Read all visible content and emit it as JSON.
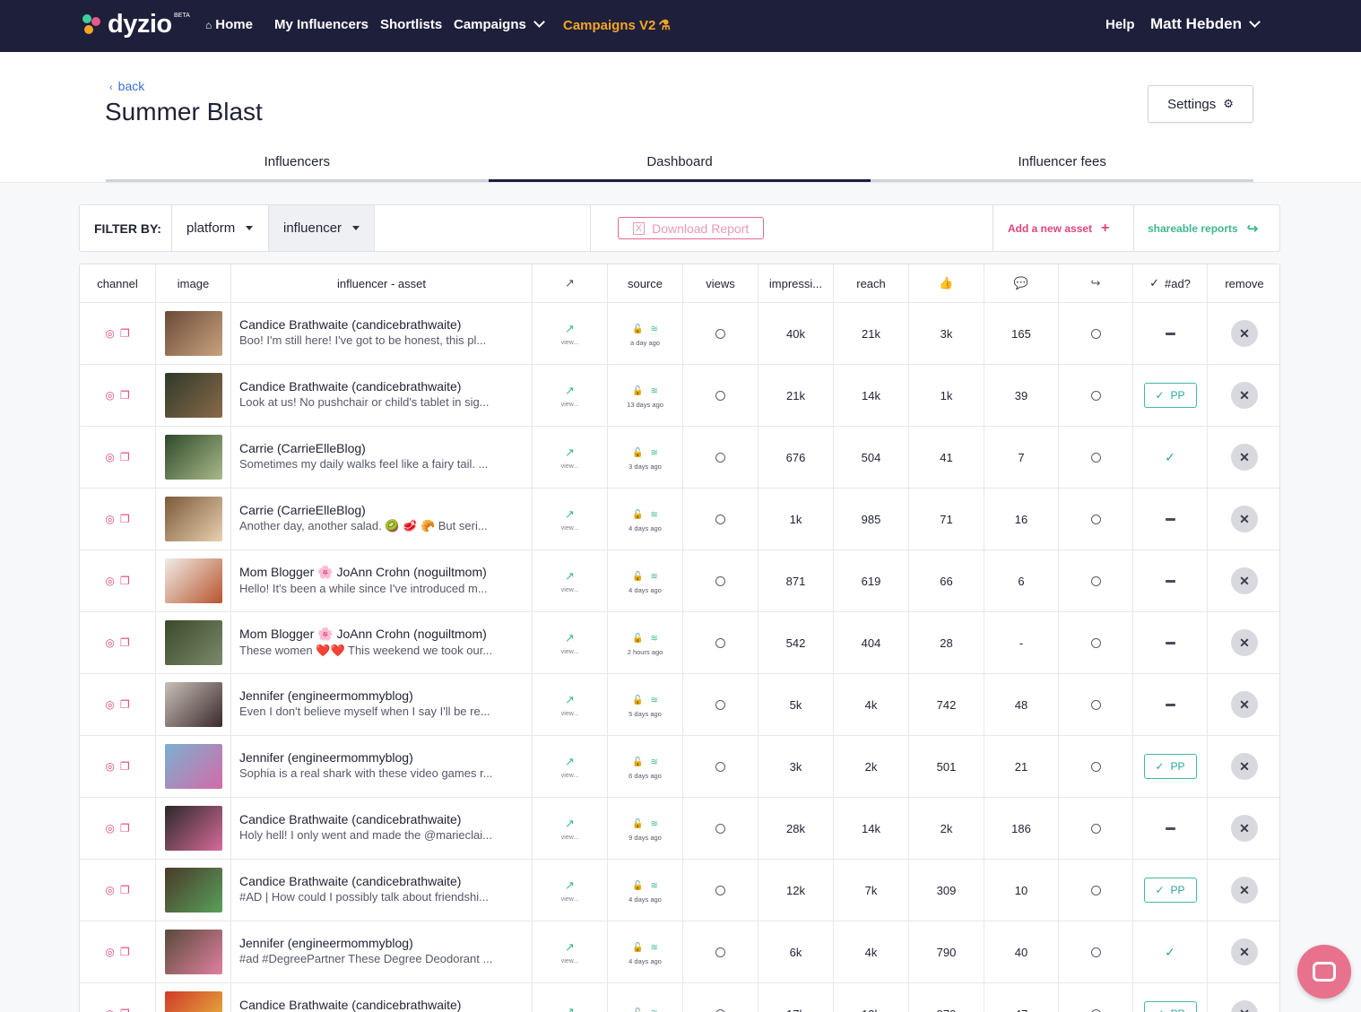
{
  "brand": {
    "name": "dyzio",
    "badge": "BETA"
  },
  "nav": {
    "home": "Home",
    "my_influencers": "My Influencers",
    "shortlists": "Shortlists",
    "campaigns": "Campaigns",
    "campaigns_v2": "Campaigns V2",
    "help": "Help",
    "user": "Matt Hebden"
  },
  "page": {
    "back": "back",
    "title": "Summer Blast",
    "settings": "Settings"
  },
  "tabs": [
    "Influencers",
    "Dashboard",
    "Influencer fees"
  ],
  "active_tab": "Dashboard",
  "filter": {
    "label": "FILTER BY:",
    "platform": "platform",
    "influencer": "influencer",
    "download": "Download Report",
    "add_asset": "Add a new asset",
    "shareable": "shareable reports"
  },
  "columns": {
    "channel": "channel",
    "image": "image",
    "asset": "influencer - asset",
    "source": "source",
    "views": "views",
    "impressions": "impressi...",
    "reach": "reach",
    "ad": "#ad?",
    "remove": "remove"
  },
  "rows": [
    {
      "name": "Candice Brathwaite (candicebrathwaite)",
      "caption": "Boo! I'm still here! I've got to be honest, this pl...",
      "view": "view...",
      "when": "a day ago",
      "impressions": "40k",
      "reach": "21k",
      "likes": "3k",
      "comments": "165",
      "ad": "dash",
      "thumb": [
        "#6b4a3a",
        "#c9a27c"
      ]
    },
    {
      "name": "Candice Brathwaite (candicebrathwaite)",
      "caption": "Look at us! No pushchair or child's tablet in sig...",
      "view": "view...",
      "when": "13 days ago",
      "impressions": "21k",
      "reach": "14k",
      "likes": "1k",
      "comments": "39",
      "ad": "pp",
      "thumb": [
        "#2e3a2a",
        "#8a6a4a"
      ]
    },
    {
      "name": "Carrie (CarrieElleBlog)",
      "caption": "Sometimes my daily walks feel like a fairy tail. ...",
      "view": "view...",
      "when": "3 days ago",
      "impressions": "676",
      "reach": "504",
      "likes": "41",
      "comments": "7",
      "ad": "check",
      "thumb": [
        "#2f4a2a",
        "#a9b98a"
      ]
    },
    {
      "name": "Carrie (CarrieElleBlog)",
      "caption": "Another day, another salad. 🥝 🥩 🥐 But seri...",
      "view": "view...",
      "when": "4 days ago",
      "impressions": "1k",
      "reach": "985",
      "likes": "71",
      "comments": "16",
      "ad": "dash",
      "thumb": [
        "#7a5a3a",
        "#e8d0b0"
      ]
    },
    {
      "name": "Mom Blogger 🌸 JoAnn Crohn (noguiltmom)",
      "caption": "Hello! It's been a while since I've introduced m...",
      "view": "view...",
      "when": "4 days ago",
      "impressions": "871",
      "reach": "619",
      "likes": "66",
      "comments": "6",
      "ad": "dash",
      "thumb": [
        "#f0ece6",
        "#b8542e"
      ]
    },
    {
      "name": "Mom Blogger 🌸 JoAnn Crohn (noguiltmom)",
      "caption": "These women ❤️❤️ This weekend we took our...",
      "view": "view...",
      "when": "2 hours ago",
      "impressions": "542",
      "reach": "404",
      "likes": "28",
      "comments": "-",
      "ad": "dash",
      "thumb": [
        "#3a4a2a",
        "#7a8a6a"
      ]
    },
    {
      "name": "Jennifer (engineermommyblog)",
      "caption": "Even I don't believe myself when I say I'll be re...",
      "view": "view...",
      "when": "5 days ago",
      "impressions": "5k",
      "reach": "4k",
      "likes": "742",
      "comments": "48",
      "ad": "dash",
      "thumb": [
        "#c8c0b8",
        "#3a2a2a"
      ]
    },
    {
      "name": "Jennifer (engineermommyblog)",
      "caption": "Sophia is a real shark with these video games r...",
      "view": "view...",
      "when": "6 days ago",
      "impressions": "3k",
      "reach": "2k",
      "likes": "501",
      "comments": "21",
      "ad": "pp",
      "thumb": [
        "#7ab0d0",
        "#d46aa8"
      ]
    },
    {
      "name": "Candice Brathwaite (candicebrathwaite)",
      "caption": "Holy hell! I only went and made the @marieclai...",
      "view": "view...",
      "when": "9 days ago",
      "impressions": "28k",
      "reach": "14k",
      "likes": "2k",
      "comments": "186",
      "ad": "dash",
      "thumb": [
        "#2a2a2a",
        "#d86a9a"
      ]
    },
    {
      "name": "Candice Brathwaite (candicebrathwaite)",
      "caption": "#AD | How could I possibly talk about friendshi...",
      "view": "view...",
      "when": "4 days ago",
      "impressions": "12k",
      "reach": "7k",
      "likes": "309",
      "comments": "10",
      "ad": "pp",
      "thumb": [
        "#4a3a2a",
        "#5aa05a"
      ]
    },
    {
      "name": "Jennifer (engineermommyblog)",
      "caption": "#ad #DegreePartner These Degree Deodorant ...",
      "view": "view...",
      "when": "4 days ago",
      "impressions": "6k",
      "reach": "4k",
      "likes": "790",
      "comments": "40",
      "ad": "check",
      "thumb": [
        "#5a4a3a",
        "#e080a0"
      ]
    },
    {
      "name": "Candice Brathwaite (candicebrathwaite)",
      "caption": "",
      "view": "",
      "when": "",
      "impressions": "17k",
      "reach": "12k",
      "likes": "970",
      "comments": "47",
      "ad": "pp",
      "thumb": [
        "#d03a2a",
        "#e8c040"
      ]
    }
  ],
  "icons": [
    "home-icon",
    "external-link-icon",
    "lock-icon",
    "rss-icon",
    "thumbs-up-icon",
    "comment-icon",
    "share-icon",
    "check-icon",
    "close-icon",
    "instagram-icon",
    "copy-icon",
    "gears-icon",
    "excel-file-icon",
    "plus-icon",
    "share-arrow-icon",
    "chat-icon"
  ],
  "colors": {
    "nav_bg": "#1e1f3b",
    "accent_orange": "#f5a623",
    "pink": "#e0447a",
    "green": "#3fb88d"
  }
}
